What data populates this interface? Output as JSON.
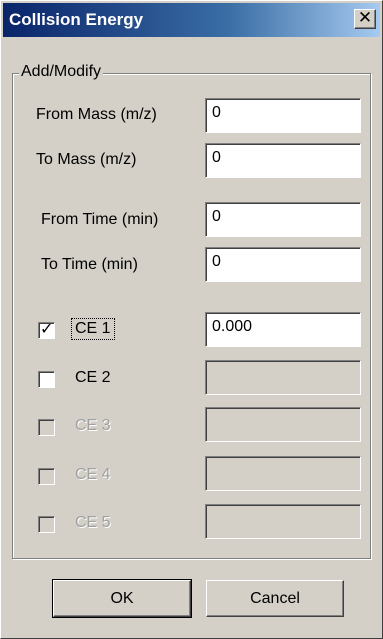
{
  "window": {
    "title": "Collision Energy",
    "close_glyph": "✕",
    "close_icon": "close-icon"
  },
  "group": {
    "legend": "Add/Modify"
  },
  "fields": {
    "from_mass": {
      "label": "From Mass (m/z)",
      "value": "0"
    },
    "to_mass": {
      "label": "To Mass (m/z)",
      "value": "0"
    },
    "from_time": {
      "label": "From Time (min)",
      "value": "0"
    },
    "to_time": {
      "label": "To Time (min)",
      "value": "0"
    }
  },
  "ce": [
    {
      "label": "CE 1",
      "checked": true,
      "enabled": true,
      "value": "0.000",
      "check_glyph": "✓"
    },
    {
      "label": "CE 2",
      "checked": false,
      "enabled": true,
      "value": ""
    },
    {
      "label": "CE 3",
      "checked": false,
      "enabled": false,
      "value": ""
    },
    {
      "label": "CE 4",
      "checked": false,
      "enabled": false,
      "value": ""
    },
    {
      "label": "CE 5",
      "checked": false,
      "enabled": false,
      "value": ""
    }
  ],
  "buttons": {
    "ok": "OK",
    "cancel": "Cancel"
  },
  "colors": {
    "titlebar": "#0a246a",
    "face": "#d4d0c8",
    "disabled_text": "#a0a0a0"
  }
}
